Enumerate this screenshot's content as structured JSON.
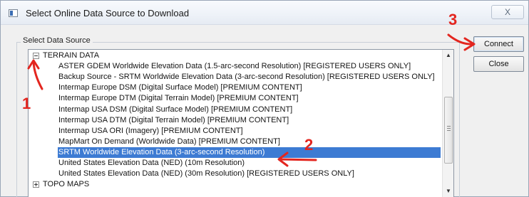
{
  "window": {
    "title": "Select Online Data Source to Download",
    "close_glyph": "X"
  },
  "group": {
    "label": "Select Data Source"
  },
  "list": {
    "items": [
      {
        "label": "TERRAIN DATA",
        "kind": "category",
        "expander": "minus"
      },
      {
        "label": "ASTER GDEM Worldwide Elevation Data (1.5-arc-second Resolution) [REGISTERED USERS ONLY]",
        "kind": "item"
      },
      {
        "label": "Backup Source - SRTM Worldwide Elevation Data (3-arc-second Resolution) [REGISTERED USERS ONLY]",
        "kind": "item"
      },
      {
        "label": "Intermap Europe DSM (Digital Surface Model) [PREMIUM CONTENT]",
        "kind": "item"
      },
      {
        "label": "Intermap Europe DTM (Digital Terrain Model) [PREMIUM CONTENT]",
        "kind": "item"
      },
      {
        "label": "Intermap USA DSM (Digital Surface Model) [PREMIUM CONTENT]",
        "kind": "item"
      },
      {
        "label": "Intermap USA DTM (Digital Terrain Model) [PREMIUM CONTENT]",
        "kind": "item"
      },
      {
        "label": "Intermap USA ORI (Imagery) [PREMIUM CONTENT]",
        "kind": "item"
      },
      {
        "label": "MapMart On Demand (Worldwide Data) [PREMIUM CONTENT]",
        "kind": "item"
      },
      {
        "label": "SRTM Worldwide Elevation Data (3-arc-second Resolution)",
        "kind": "item",
        "selected": true
      },
      {
        "label": "United States Elevation Data (NED) (10m Resolution)",
        "kind": "item"
      },
      {
        "label": "United States Elevation Data (NED) (30m Resolution) [REGISTERED USERS ONLY]",
        "kind": "item"
      },
      {
        "label": "TOPO MAPS",
        "kind": "category",
        "expander": "plus"
      }
    ]
  },
  "buttons": {
    "connect": "Connect",
    "close": "Close"
  },
  "annotations": {
    "step1": "1",
    "step2": "2",
    "step3": "3",
    "color": "#e3261f"
  },
  "colors": {
    "selection": "#3d7bd3",
    "dialog_bg": "#f0f0f0"
  },
  "icons": {
    "scroll_up": "▲",
    "scroll_down": "▼"
  }
}
